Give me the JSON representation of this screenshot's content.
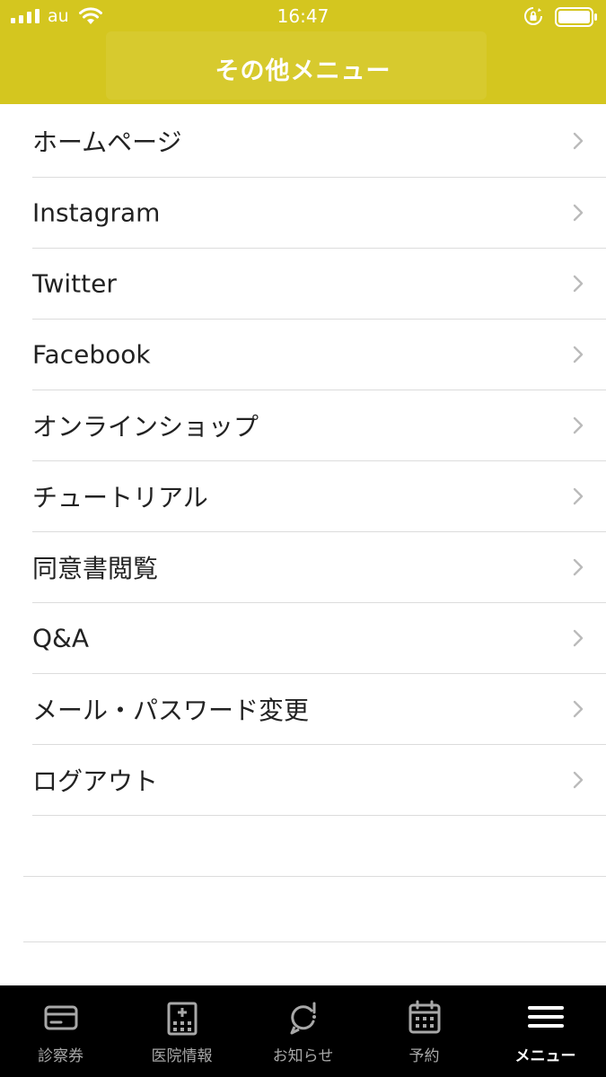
{
  "status_bar": {
    "carrier": "au",
    "time": "16:47"
  },
  "header": {
    "title": "その他メニュー",
    "color": "#d4c61f"
  },
  "menu": {
    "items": [
      {
        "label": "ホームページ",
        "name": "home-page"
      },
      {
        "label": "Instagram",
        "name": "instagram"
      },
      {
        "label": "Twitter",
        "name": "twitter"
      },
      {
        "label": "Facebook",
        "name": "facebook"
      },
      {
        "label": "オンラインショップ",
        "name": "online-shop"
      },
      {
        "label": "チュートリアル",
        "name": "tutorial"
      },
      {
        "label": "同意書閲覧",
        "name": "consent-form"
      },
      {
        "label": "Q&A",
        "name": "qa"
      },
      {
        "label": "メール・パスワード変更",
        "name": "email-password-change"
      },
      {
        "label": "ログアウト",
        "name": "logout"
      }
    ],
    "chevron_icon": "chevron-right-icon"
  },
  "tab_bar": {
    "tabs": [
      {
        "label": "診察券",
        "icon": "card-icon"
      },
      {
        "label": "医院情報",
        "icon": "hospital-icon"
      },
      {
        "label": "お知らせ",
        "icon": "notification-icon"
      },
      {
        "label": "予約",
        "icon": "calendar-icon"
      },
      {
        "label": "メニュー",
        "icon": "hamburger-menu-icon",
        "active": true
      }
    ]
  }
}
